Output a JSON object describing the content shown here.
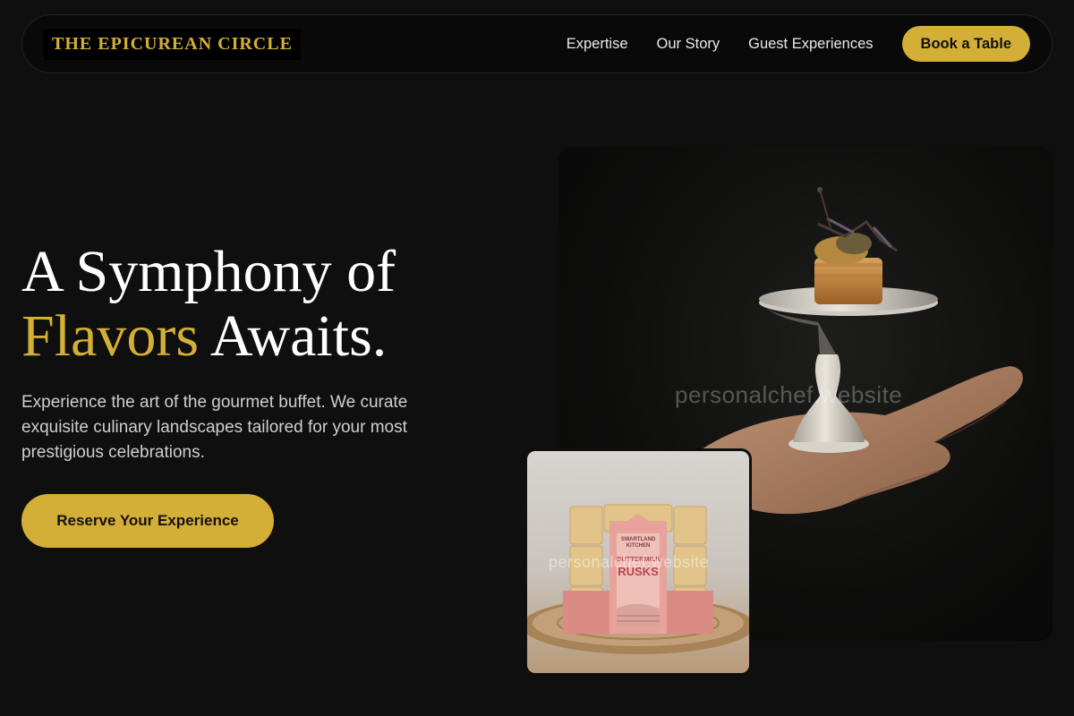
{
  "nav": {
    "brand": "THE EPICUREAN CIRCLE",
    "links": [
      {
        "label": "Expertise"
      },
      {
        "label": "Our Story"
      },
      {
        "label": "Guest Experiences"
      }
    ],
    "cta_label": "Book a Table"
  },
  "hero": {
    "title_line1": "A Symphony of",
    "title_accent": "Flavors",
    "title_line2_rest": " Awaits.",
    "subtitle": "Experience the art of the gourmet buffet. We curate exquisite culinary landscapes tailored for your most prestigious celebrations.",
    "cta_label": "Reserve Your Experience"
  },
  "images": {
    "main_watermark": "personalchef.website",
    "secondary_watermark": "personalchef.website",
    "package_brand": "SWARTLAND KITCHEN",
    "package_product_line1": "BUTTERMILK",
    "package_product_line2": "RUSKS"
  },
  "colors": {
    "accent": "#d4af37",
    "background": "#0f0f0f",
    "nav_background": "#090909"
  }
}
